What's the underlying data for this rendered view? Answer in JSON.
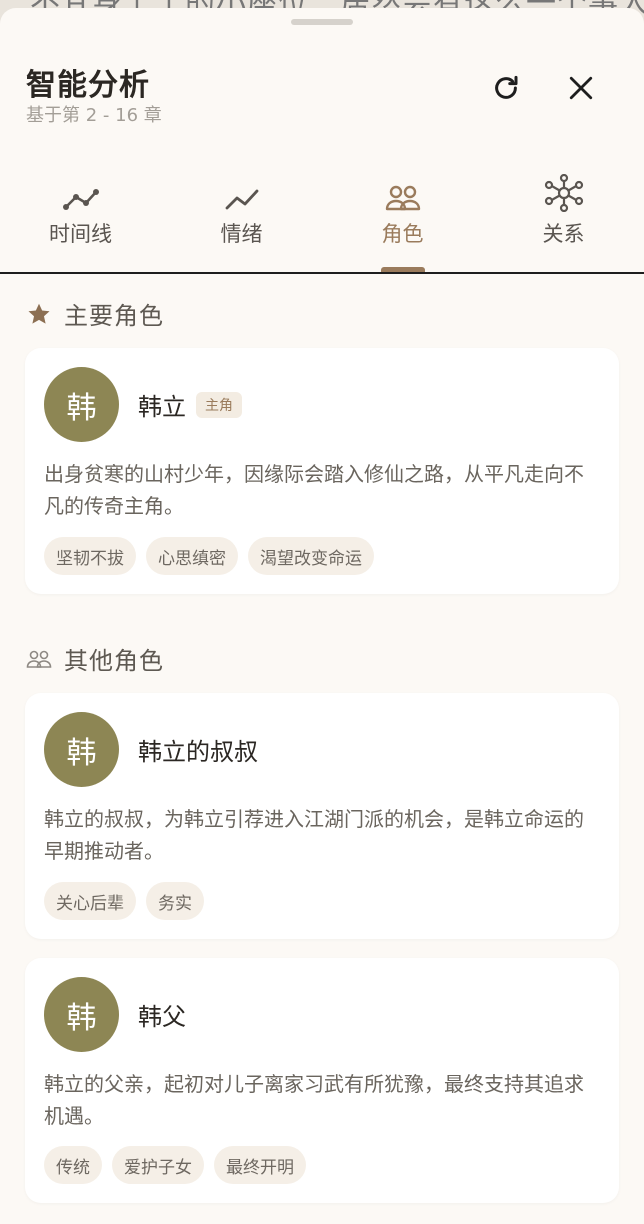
{
  "background_text": "不甘身上士的小座位…居然会有这么一个事人",
  "header": {
    "title": "智能分析",
    "subtitle": "基于第 2 - 16 章",
    "refresh_icon": "refresh-icon",
    "close_icon": "close-icon"
  },
  "tabs": [
    {
      "label": "时间线",
      "icon": "timeline-icon",
      "active": false
    },
    {
      "label": "情绪",
      "icon": "trend-icon",
      "active": false
    },
    {
      "label": "角色",
      "icon": "people-icon",
      "active": true
    },
    {
      "label": "关系",
      "icon": "network-icon",
      "active": false
    }
  ],
  "main_section": {
    "title": "主要角色",
    "icon": "star-icon",
    "characters": [
      {
        "avatar": "韩",
        "name": "韩立",
        "badge": "主角",
        "description": "出身贫寒的山村少年，因缘际会踏入修仙之路，从平凡走向不凡的传奇主角。",
        "tags": [
          "坚韧不拔",
          "心思缜密",
          "渴望改变命运"
        ]
      }
    ]
  },
  "other_section": {
    "title": "其他角色",
    "icon": "people-outline-icon",
    "characters": [
      {
        "avatar": "韩",
        "name": "韩立的叔叔",
        "description": "韩立的叔叔，为韩立引荐进入江湖门派的机会，是韩立命运的早期推动者。",
        "tags": [
          "关心后辈",
          "务实"
        ]
      },
      {
        "avatar": "韩",
        "name": "韩父",
        "description": "韩立的父亲，起初对儿子离家习武有所犹豫，最终支持其追求机遇。",
        "tags": [
          "传统",
          "爱护子女",
          "最终开明"
        ]
      }
    ]
  },
  "colors": {
    "accent": "#9a7b5c",
    "avatar": "#8d8654",
    "sheet_bg": "#fcf9f5"
  }
}
